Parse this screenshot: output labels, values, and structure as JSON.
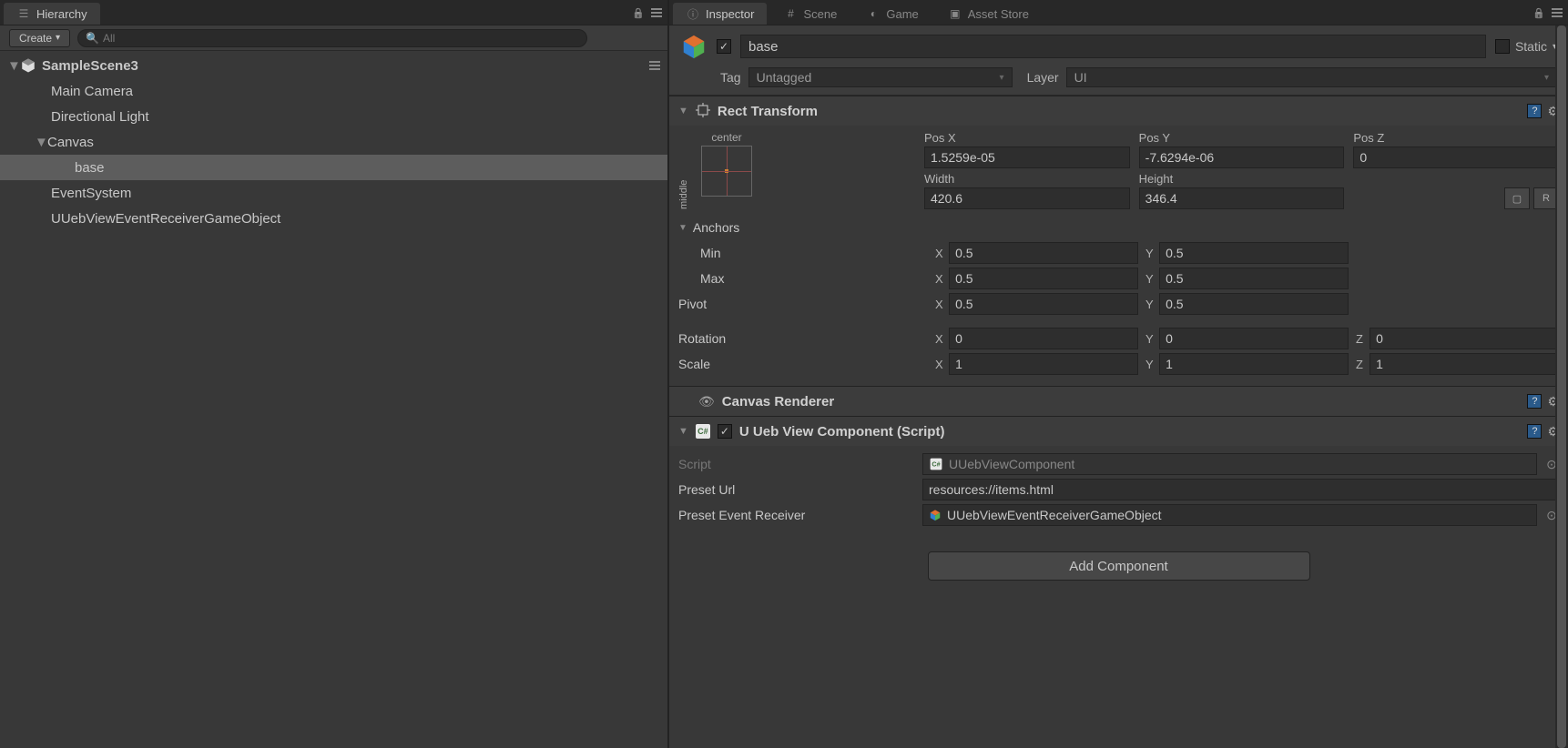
{
  "hierarchy": {
    "tab_label": "Hierarchy",
    "create_label": "Create",
    "search_placeholder": "All",
    "scene_name": "SampleScene3",
    "items": [
      {
        "label": "Main Camera",
        "indent": 1,
        "selected": false
      },
      {
        "label": "Directional Light",
        "indent": 1,
        "selected": false
      },
      {
        "label": "Canvas",
        "indent": 1,
        "selected": false,
        "arrow": "▼"
      },
      {
        "label": "base",
        "indent": 2,
        "selected": true
      },
      {
        "label": "EventSystem",
        "indent": 1,
        "selected": false
      },
      {
        "label": "UUebViewEventReceiverGameObject",
        "indent": 1,
        "selected": false
      }
    ]
  },
  "inspector": {
    "tabs": [
      {
        "label": "Inspector",
        "active": true,
        "icon": "info"
      },
      {
        "label": "Scene",
        "active": false,
        "icon": "hash"
      },
      {
        "label": "Game",
        "active": false,
        "icon": "pac"
      },
      {
        "label": "Asset Store",
        "active": false,
        "icon": "store"
      }
    ],
    "object_name": "base",
    "static_label": "Static",
    "tag_label": "Tag",
    "tag_value": "Untagged",
    "layer_label": "Layer",
    "layer_value": "UI",
    "rect_transform": {
      "title": "Rect Transform",
      "anchor_h": "center",
      "anchor_v": "middle",
      "pos_x_label": "Pos X",
      "pos_x": "1.5259e-05",
      "pos_y_label": "Pos Y",
      "pos_y": "-7.6294e-06",
      "pos_z_label": "Pos Z",
      "pos_z": "0",
      "width_label": "Width",
      "width": "420.6",
      "height_label": "Height",
      "height": "346.4",
      "anchors_label": "Anchors",
      "min_label": "Min",
      "min_x": "0.5",
      "min_y": "0.5",
      "max_label": "Max",
      "max_x": "0.5",
      "max_y": "0.5",
      "pivot_label": "Pivot",
      "pivot_x": "0.5",
      "pivot_y": "0.5",
      "rotation_label": "Rotation",
      "rot_x": "0",
      "rot_y": "0",
      "rot_z": "0",
      "scale_label": "Scale",
      "scale_x": "1",
      "scale_y": "1",
      "scale_z": "1"
    },
    "canvas_renderer": {
      "title": "Canvas Renderer"
    },
    "uueb": {
      "title": "U Ueb View Component (Script)",
      "script_label": "Script",
      "script_value": "UUebViewComponent",
      "preset_url_label": "Preset Url",
      "preset_url_value": "resources://items.html",
      "preset_receiver_label": "Preset Event Receiver",
      "preset_receiver_value": "UUebViewEventReceiverGameObject"
    },
    "add_component_label": "Add Component"
  }
}
